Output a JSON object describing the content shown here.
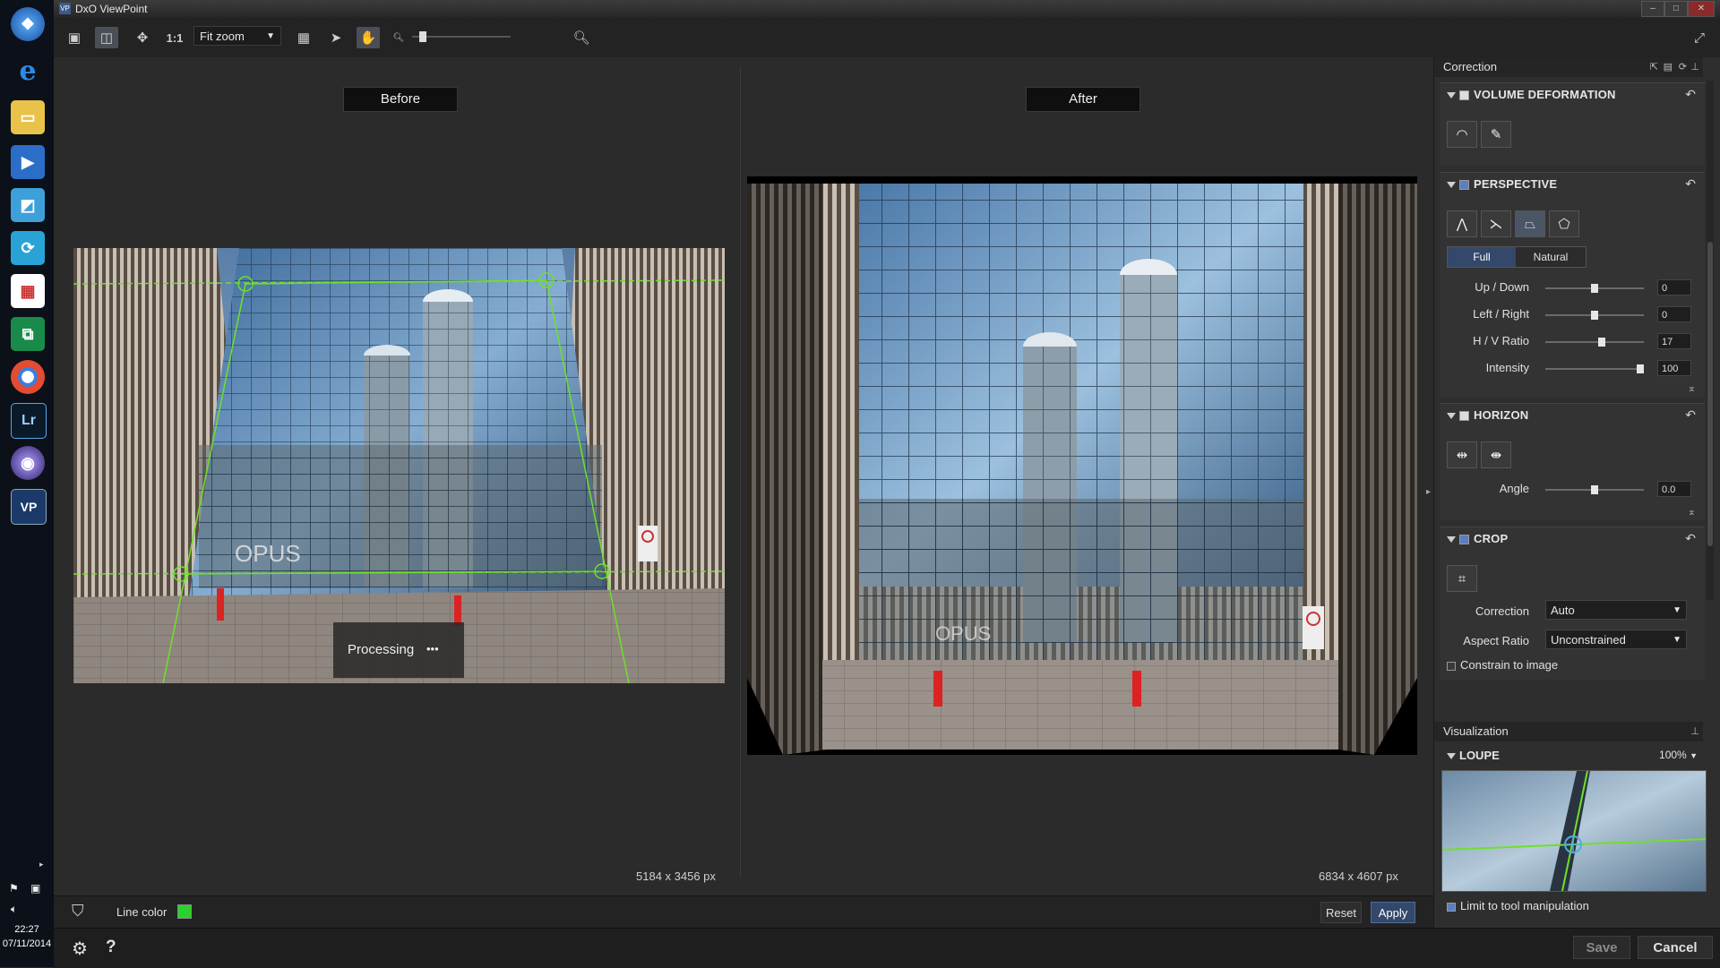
{
  "taskbar": {
    "clock_time": "22:27",
    "clock_date": "07/11/2014",
    "lr_label": "Lr",
    "vp_label": "VP"
  },
  "window": {
    "title": "DxO ViewPoint",
    "logo": "VP"
  },
  "toolbar": {
    "one_to_one": "1:1",
    "zoom_select": "Fit zoom"
  },
  "viewer": {
    "before_label": "Before",
    "after_label": "After",
    "before_dims": "5184 x 3456 px",
    "after_dims": "6834 x 4607 px",
    "processing_text": "Processing",
    "processing_dots": "•••",
    "sign_text": "OPUS"
  },
  "bottombar": {
    "line_color_label": "Line color",
    "line_color_value": "#2bd12b",
    "reset_label": "Reset",
    "apply_label": "Apply"
  },
  "footer": {
    "save_label": "Save",
    "cancel_label": "Cancel",
    "help_label": "?"
  },
  "correction_panel": {
    "title": "Correction",
    "volume_deformation": {
      "title": "VOLUME DEFORMATION"
    },
    "perspective": {
      "title": "PERSPECTIVE",
      "mode_full": "Full",
      "mode_natural": "Natural",
      "sliders": [
        {
          "label": "Up / Down",
          "value": "0",
          "fraction": 0.5
        },
        {
          "label": "Left / Right",
          "value": "0",
          "fraction": 0.5
        },
        {
          "label": "H / V Ratio",
          "value": "17",
          "fraction": 0.58
        },
        {
          "label": "Intensity",
          "value": "100",
          "fraction": 1.0
        }
      ]
    },
    "horizon": {
      "title": "HORIZON",
      "angle_label": "Angle",
      "angle_value": "0.0",
      "angle_fraction": 0.5
    },
    "crop": {
      "title": "CROP",
      "correction_label": "Correction",
      "correction_value": "Auto",
      "aspect_label": "Aspect Ratio",
      "aspect_value": "Unconstrained",
      "constrain_label": "Constrain to image"
    }
  },
  "visualization_panel": {
    "title": "Visualization",
    "loupe_title": "LOUPE",
    "loupe_zoom": "100%",
    "limit_label": "Limit to tool manipulation"
  },
  "colors": {
    "accent": "#33486a",
    "guide_line": "#6fe02a"
  }
}
